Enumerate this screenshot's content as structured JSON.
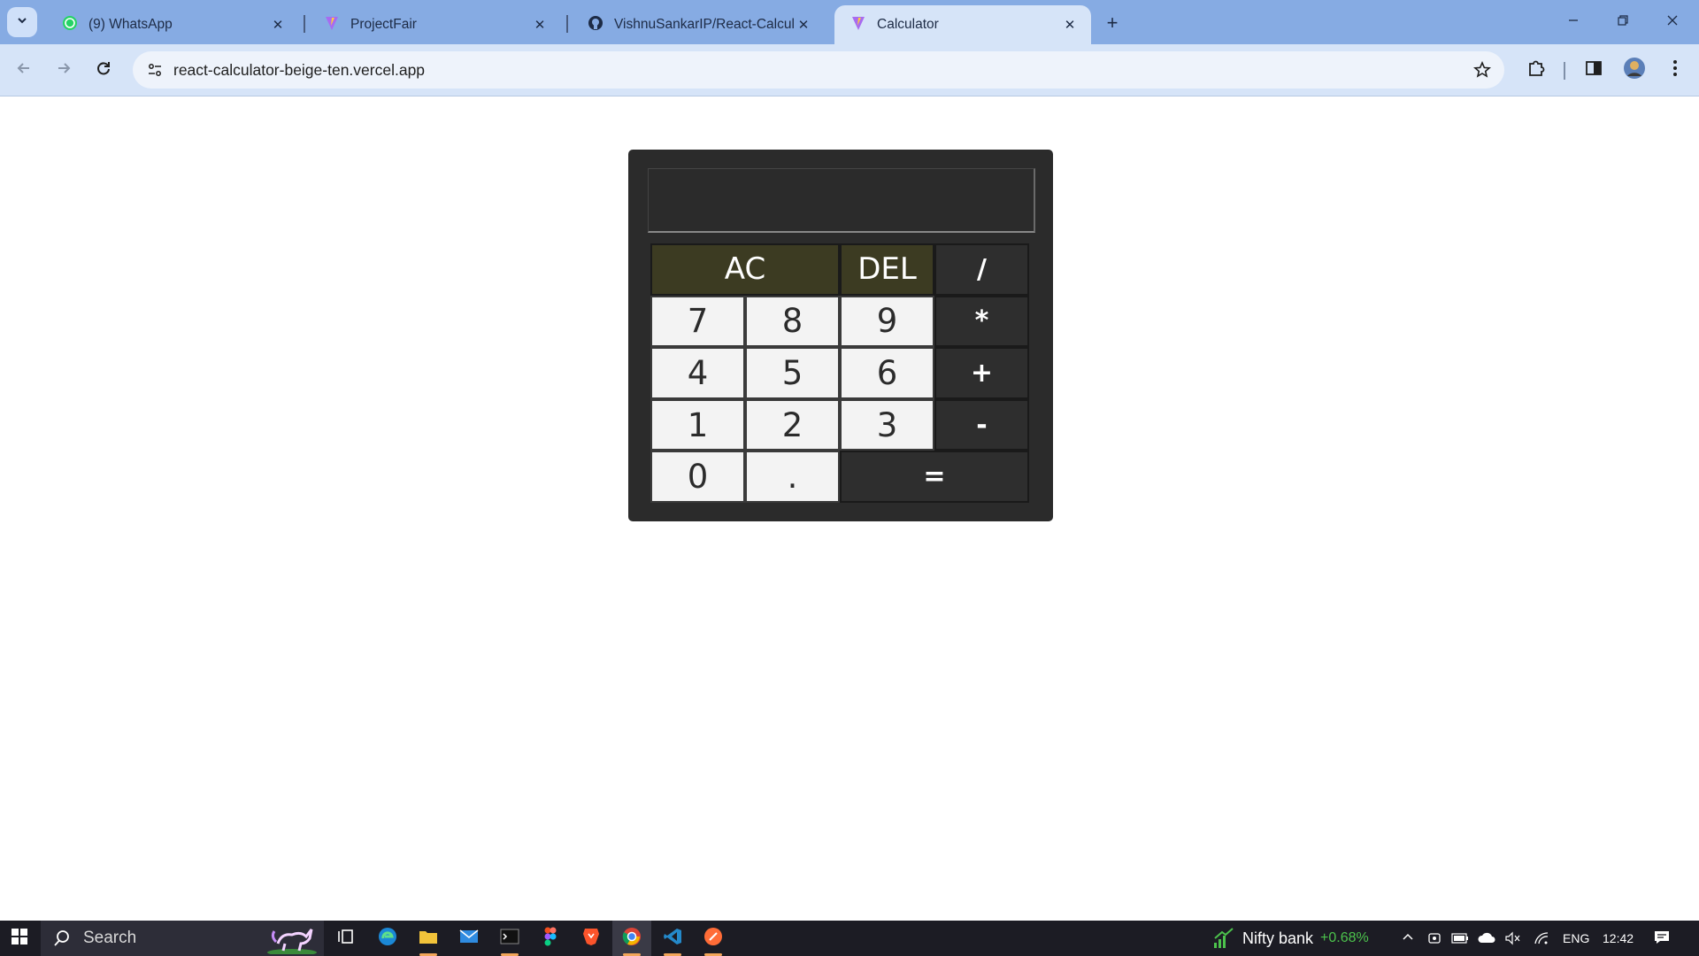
{
  "browser": {
    "tabs": [
      {
        "title": "(9) WhatsApp",
        "icon": "whatsapp-icon",
        "active": false
      },
      {
        "title": "ProjectFair",
        "icon": "vite-icon",
        "active": false
      },
      {
        "title": "VishnuSankarIP/React-Calculator",
        "icon": "github-icon",
        "active": false
      },
      {
        "title": "Calculator",
        "icon": "vite-icon",
        "active": true
      }
    ],
    "url": "react-calculator-beige-ten.vercel.app"
  },
  "calculator": {
    "display": "",
    "keys": [
      {
        "label": "AC",
        "kind": "ctrl",
        "span": 2
      },
      {
        "label": "DEL",
        "kind": "ctrl",
        "span": 1
      },
      {
        "label": "/",
        "kind": "op",
        "span": 1
      },
      {
        "label": "7",
        "kind": "num",
        "span": 1
      },
      {
        "label": "8",
        "kind": "num",
        "span": 1
      },
      {
        "label": "9",
        "kind": "num",
        "span": 1
      },
      {
        "label": "*",
        "kind": "op",
        "span": 1
      },
      {
        "label": "4",
        "kind": "num",
        "span": 1
      },
      {
        "label": "5",
        "kind": "num",
        "span": 1
      },
      {
        "label": "6",
        "kind": "num",
        "span": 1
      },
      {
        "label": "+",
        "kind": "op",
        "span": 1
      },
      {
        "label": "1",
        "kind": "num",
        "span": 1
      },
      {
        "label": "2",
        "kind": "num",
        "span": 1
      },
      {
        "label": "3",
        "kind": "num",
        "span": 1
      },
      {
        "label": "-",
        "kind": "op",
        "span": 1
      },
      {
        "label": "0",
        "kind": "num",
        "span": 1
      },
      {
        "label": ".",
        "kind": "num",
        "span": 1
      },
      {
        "label": "=",
        "kind": "op",
        "span": 2
      }
    ]
  },
  "taskbar": {
    "search_label": "Search",
    "ticker_name": "Nifty bank",
    "ticker_change": "+0.68%",
    "language": "ENG",
    "time": "12:42"
  },
  "colors": {
    "tabstrip": "#86abe3",
    "toolbar": "#d6e4f8",
    "calculator_body": "#2b2b2b",
    "ctrl_key": "#3c3b22",
    "num_key": "#f3f3f3",
    "ticker_positive": "#4cc24c"
  }
}
